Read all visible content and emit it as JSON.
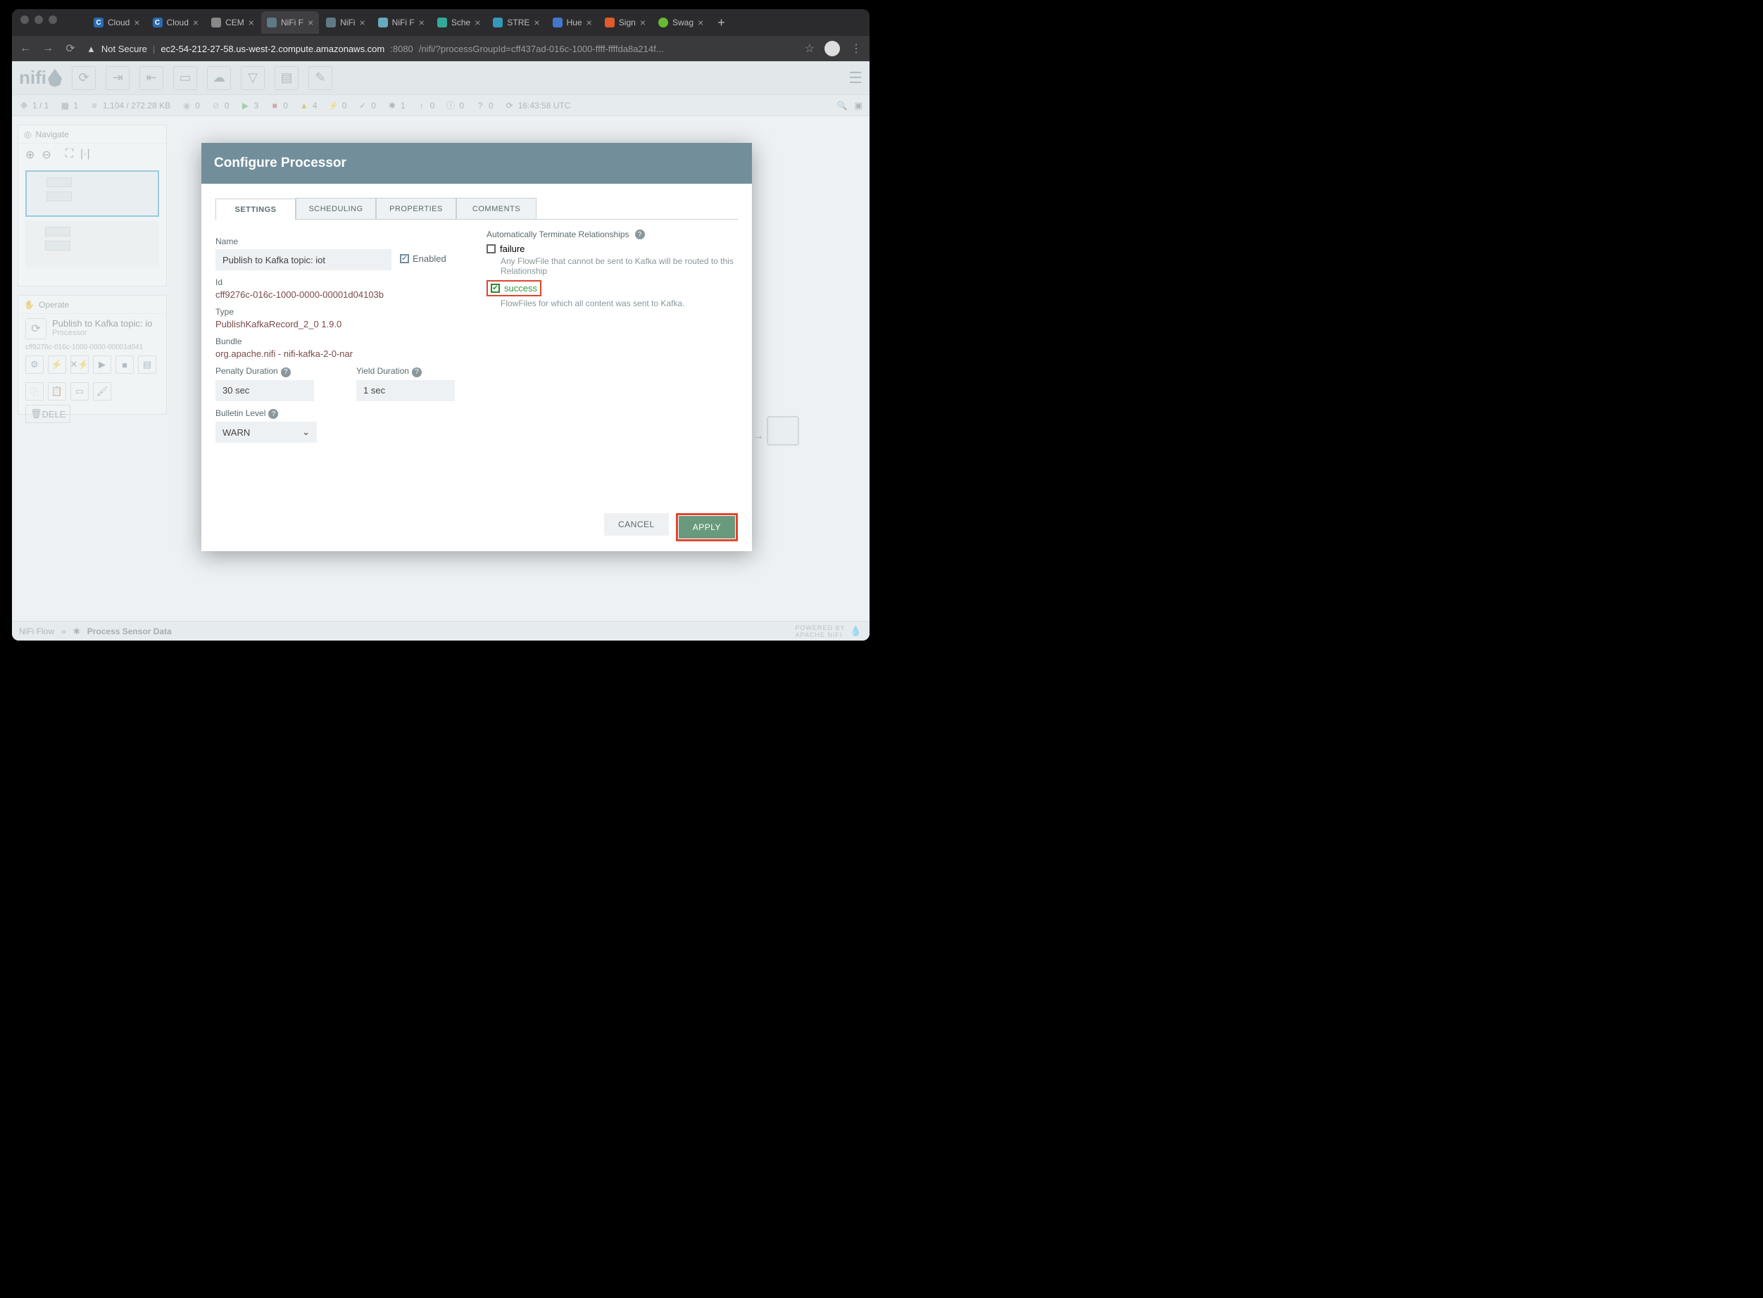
{
  "browser": {
    "tabs": [
      {
        "title": "Cloud",
        "icon": "#2b6cb0"
      },
      {
        "title": "Cloud",
        "icon": "#2b6cb0"
      },
      {
        "title": "CEM",
        "icon": "#888"
      },
      {
        "title": "NiFi F",
        "icon": "#5f7a87",
        "active": true
      },
      {
        "title": "NiFi",
        "icon": "#5f7a87"
      },
      {
        "title": "NiFi F",
        "icon": "#6aa"
      },
      {
        "title": "Sche",
        "icon": "#3a9"
      },
      {
        "title": "STRE",
        "icon": "#39b"
      },
      {
        "title": "Hue",
        "icon": "#47c"
      },
      {
        "title": "Sign",
        "icon": "#e05"
      },
      {
        "title": "Swag",
        "icon": "#6b3"
      }
    ],
    "secure_label": "Not Secure",
    "url_host": "ec2-54-212-27-58.us-west-2.compute.amazonaws.com",
    "url_port": ":8080",
    "url_path": "/nifi/?processGroupId=cff437ad-016c-1000-ffff-ffffda8a214f..."
  },
  "nifi": {
    "logo": "nifi",
    "stats": {
      "groups": "1 / 1",
      "threads": "1",
      "queue": "1,104 / 272.28 KB",
      "transmitting": "0",
      "not_transmitting": "0",
      "running": "3",
      "stopped": "0",
      "invalid": "4",
      "disabled": "0",
      "up_to_date": "0",
      "locally_modified": "1",
      "stale": "0",
      "sync_failure": "0",
      "unknown": "0",
      "refresh_time": "16:43:58 UTC"
    },
    "navigate": {
      "title": "Navigate"
    },
    "operate": {
      "title": "Operate",
      "name": "Publish to Kafka topic: io",
      "type": "Processor",
      "id": "cff9276c-016c-1000-0000-00001d041",
      "delete": "DELE"
    },
    "breadcrumb": {
      "root": "NiFi Flow",
      "sep": "»",
      "current": "Process Sensor Data"
    },
    "footer": "POWERED BY\nAPACHE NIFI"
  },
  "dialog": {
    "title": "Configure Processor",
    "tabs": [
      "SETTINGS",
      "SCHEDULING",
      "PROPERTIES",
      "COMMENTS"
    ],
    "name_label": "Name",
    "name_value": "Publish to Kafka topic: iot",
    "enabled_label": "Enabled",
    "id_label": "Id",
    "id_value": "cff9276c-016c-1000-0000-00001d04103b",
    "type_label": "Type",
    "type_value": "PublishKafkaRecord_2_0 1.9.0",
    "bundle_label": "Bundle",
    "bundle_value": "org.apache.nifi - nifi-kafka-2-0-nar",
    "penalty_label": "Penalty Duration",
    "penalty_value": "30 sec",
    "yield_label": "Yield Duration",
    "yield_value": "1 sec",
    "bulletin_label": "Bulletin Level",
    "bulletin_value": "WARN",
    "rel_label": "Automatically Terminate Relationships",
    "rel_failure": "failure",
    "rel_failure_desc": "Any FlowFile that cannot be sent to Kafka will be routed to this Relationship",
    "rel_success": "success",
    "rel_success_desc": "FlowFiles for which all content was sent to Kafka.",
    "cancel": "CANCEL",
    "apply": "APPLY"
  }
}
